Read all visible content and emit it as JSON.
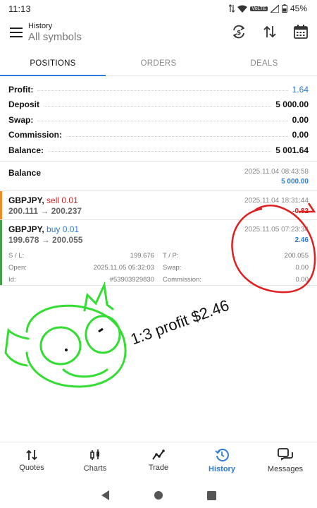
{
  "status": {
    "time": "11:13",
    "network": "VoLTE",
    "battery": "45%"
  },
  "appbar": {
    "subtitle": "History",
    "title": "All symbols",
    "icons": [
      "menu-icon",
      "currency-swap-icon",
      "sort-icon",
      "calendar-icon"
    ]
  },
  "tabs": [
    "POSITIONS",
    "ORDERS",
    "DEALS"
  ],
  "active_tab": "POSITIONS",
  "summary": [
    {
      "label": "Profit:",
      "value": "1.64",
      "color": "#2f7bd8"
    },
    {
      "label": "Deposit",
      "value": "5 000.00"
    },
    {
      "label": "Swap:",
      "value": "0.00"
    },
    {
      "label": "Commission:",
      "value": "0.00"
    },
    {
      "label": "Balance:",
      "value": "5 001.64"
    }
  ],
  "balance_entry": {
    "label": "Balance",
    "timestamp": "2025.11.04 08:43:58",
    "amount": "5 000.00"
  },
  "deals": [
    {
      "symbol": "GBPJPY,",
      "side": "sell 0.01",
      "prices": "200.111 → 200.237",
      "timestamp": "2025.11.04 18:31:44",
      "profit": "-0.82",
      "edge_color": "#f08a24"
    },
    {
      "symbol": "GBPJPY,",
      "side": "buy 0.01",
      "prices": "199.678 → 200.055",
      "timestamp": "2025.11.05 07:23:34",
      "profit": "2.46",
      "edge_color": "#43a047",
      "details": {
        "sl_label": "S / L:",
        "sl_value": "199.676",
        "tp_label": "T / P:",
        "tp_value": "200.055",
        "open_label": "Open:",
        "open_value": "2025.11.05 05:32:03",
        "swap_label": "Swap:",
        "swap_value": "0.00",
        "id_label": "Id:",
        "id_value": "#53903929830",
        "commission_label": "Commission:",
        "commission_value": "0.00"
      }
    }
  ],
  "annotation": {
    "text": "1:3 profit $2.46"
  },
  "bottom_nav": [
    {
      "label": "Quotes",
      "icon": "quotes-icon"
    },
    {
      "label": "Charts",
      "icon": "charts-icon"
    },
    {
      "label": "Trade",
      "icon": "trade-icon"
    },
    {
      "label": "History",
      "icon": "history-icon",
      "active": true
    },
    {
      "label": "Messages",
      "icon": "messages-icon"
    }
  ],
  "colors": {
    "accent": "#2f7bd8",
    "negative": "#c62828",
    "annotation_circle": "#e02020",
    "annotation_drawing": "#33dd33"
  }
}
